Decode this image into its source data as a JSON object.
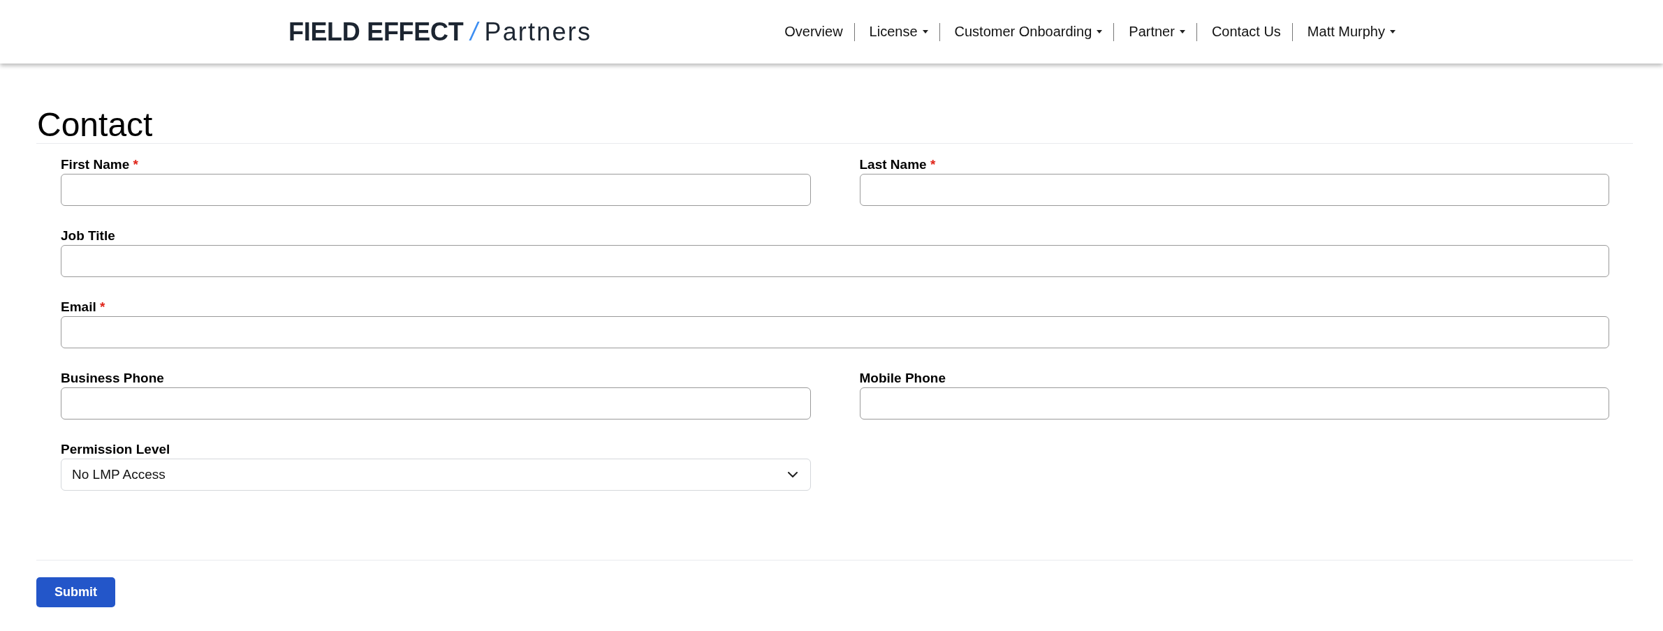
{
  "header": {
    "logo": {
      "brand": "FIELD EFFECT",
      "slash": "/",
      "product": "Partners"
    },
    "nav": [
      {
        "label": "Overview",
        "dropdown": false
      },
      {
        "label": "License",
        "dropdown": true
      },
      {
        "label": "Customer Onboarding",
        "dropdown": true
      },
      {
        "label": "Partner",
        "dropdown": true
      },
      {
        "label": "Contact Us",
        "dropdown": false
      },
      {
        "label": "Matt Murphy",
        "dropdown": true
      }
    ]
  },
  "page": {
    "title": "Contact"
  },
  "form": {
    "rows": [
      [
        {
          "kind": "text",
          "label": "First Name",
          "required_mark": "*"
        },
        {
          "kind": "text",
          "label": "Last Name",
          "required_mark": "*"
        }
      ],
      [
        {
          "kind": "text",
          "label": "Job Title"
        }
      ],
      [
        {
          "kind": "text",
          "label": "Email",
          "required_mark": "*"
        }
      ],
      [
        {
          "kind": "text",
          "label": "Business Phone"
        },
        {
          "kind": "text",
          "label": "Mobile Phone"
        }
      ],
      [
        {
          "kind": "select",
          "label": "Permission Level",
          "value": "No LMP Access"
        }
      ]
    ],
    "submit": {
      "label": "Submit"
    }
  }
}
